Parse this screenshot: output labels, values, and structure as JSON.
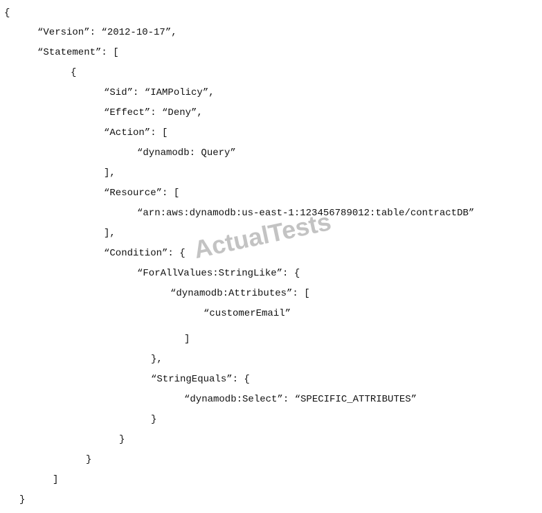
{
  "policy_lines": [
    "{",
    "“Version”: “2012-10-17”,",
    "“Statement”: [",
    "{",
    "“Sid”: “IAMPolicy”,",
    "“Effect”: “Deny”,",
    "“Action”: [",
    "“dynamodb: Query”",
    "],",
    "“Resource”: [",
    "“arn:aws:dynamodb:us-east-1:123456789012:table/contractDB”",
    "],",
    "“Condition”: {",
    "“ForAllValues:StringLike”: {",
    "“dynamodb:Attributes”: [",
    "“customerEmail”",
    "]",
    "},",
    "“StringEquals”: {",
    "“dynamodb:Select”: “SPECIFIC_ATTRIBUTES”",
    "}",
    "}",
    "}",
    "]",
    "}"
  ],
  "watermark": "ActualTests"
}
